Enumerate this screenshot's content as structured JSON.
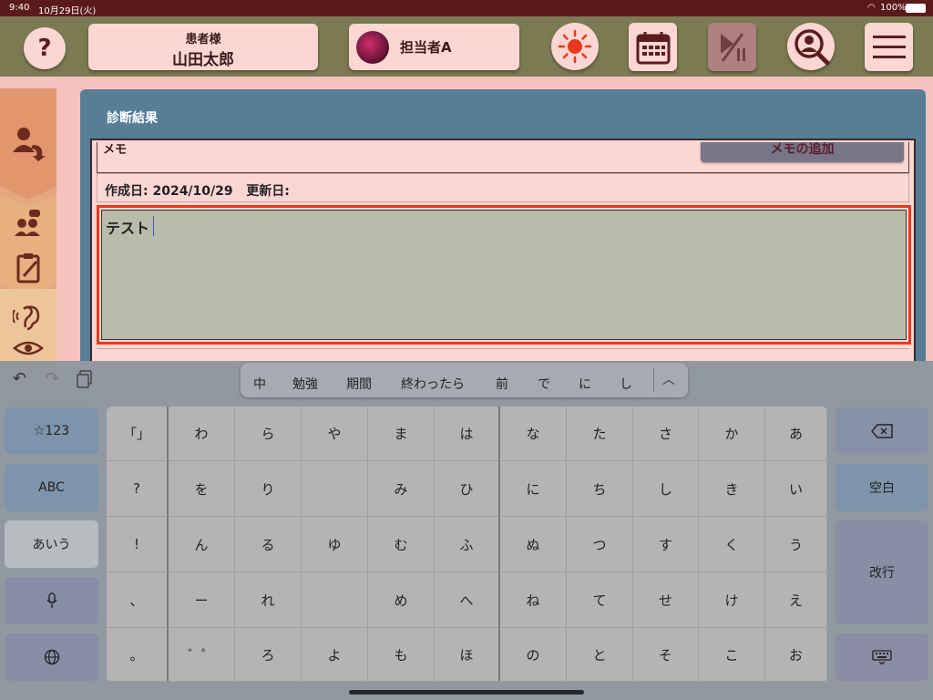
{
  "status": {
    "time": "9:40",
    "date": "10月29日(火)",
    "battery": "100%"
  },
  "header": {
    "help_label": "?",
    "patient_caption": "患者様",
    "patient_name": "山田太郎",
    "staff_name": "担当者A"
  },
  "panel": {
    "title": "診断結果",
    "memo_label": "メモ",
    "add_memo_label": "メモの追加",
    "dates": "作成日: 2024/10/29   更新日:",
    "memo_text": "テスト"
  },
  "keyboard": {
    "candidates": [
      "中",
      "勉強",
      "期間",
      "終わったら",
      "前",
      "で",
      "に",
      "し"
    ],
    "left_keys": [
      "☆123",
      "ABC",
      "あいう",
      "",
      ""
    ],
    "right_keys": {
      "delete": "",
      "space": "空白",
      "enter": "改行",
      "hide": ""
    },
    "columns": [
      [
        "「」",
        "?",
        "!",
        "、",
        "。"
      ],
      [
        "わ",
        "を",
        "ん",
        "ー",
        "゛゜"
      ],
      [
        "ら",
        "り",
        "る",
        "れ",
        "ろ"
      ],
      [
        "や",
        "",
        "ゆ",
        "",
        "よ"
      ],
      [
        "ま",
        "み",
        "む",
        "め",
        "も"
      ],
      [
        "は",
        "ひ",
        "ふ",
        "へ",
        "ほ"
      ],
      [
        "な",
        "に",
        "ぬ",
        "ね",
        "の"
      ],
      [
        "た",
        "ち",
        "つ",
        "て",
        "と"
      ],
      [
        "さ",
        "し",
        "す",
        "せ",
        "そ"
      ],
      [
        "か",
        "き",
        "く",
        "け",
        "こ"
      ],
      [
        "あ",
        "い",
        "う",
        "え",
        "お"
      ]
    ]
  },
  "colors": {
    "accent": "#e8391e",
    "pink": "#fcd6d2",
    "panel": "#567e97",
    "olive": "#7b7a52"
  }
}
